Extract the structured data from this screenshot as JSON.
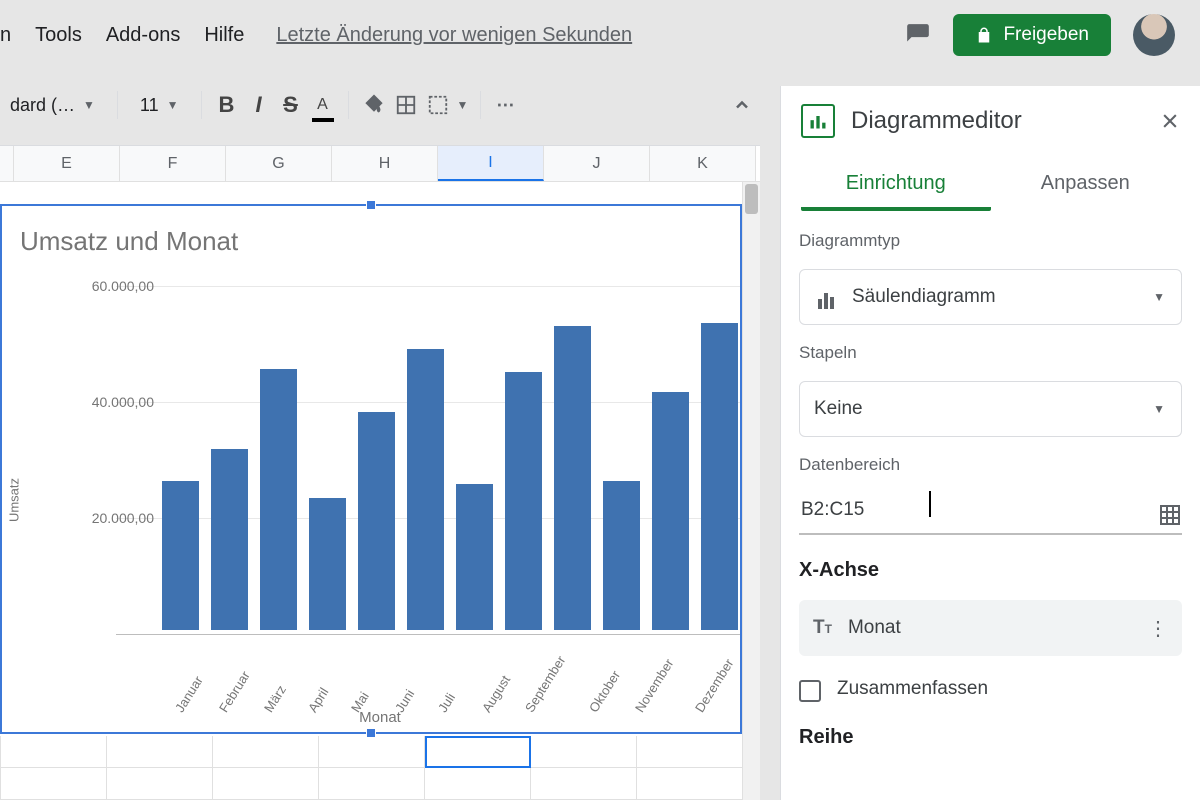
{
  "menu": {
    "items": [
      "n",
      "Tools",
      "Add-ons",
      "Hilfe"
    ],
    "last_change": "Letzte Änderung vor wenigen Sekunden"
  },
  "toolbar": {
    "font_name": "dard (…",
    "font_size": "11"
  },
  "share_label": "Freigeben",
  "columns": [
    "E",
    "F",
    "G",
    "H",
    "I",
    "J",
    "K"
  ],
  "selected_column_index": 4,
  "chart_data": {
    "type": "bar",
    "title": "Umsatz und Monat",
    "xlabel": "Monat",
    "ylabel": "Umsatz",
    "ylim": [
      0,
      60000
    ],
    "y_ticks": [
      "60.000,00",
      "40.000,00",
      "20.000,00"
    ],
    "categories": [
      "Januar",
      "Februar",
      "März",
      "April",
      "Mai",
      "Juni",
      "Juli",
      "August",
      "September",
      "Oktober",
      "November",
      "Dezember"
    ],
    "values": [
      26000,
      31500,
      45500,
      23000,
      38000,
      49000,
      25500,
      45000,
      53000,
      26000,
      41500,
      53500
    ]
  },
  "editor": {
    "title": "Diagrammeditor",
    "tabs": {
      "setup": "Einrichtung",
      "customize": "Anpassen"
    },
    "chart_type_label": "Diagrammtyp",
    "chart_type_value": "Säulendiagramm",
    "stacking_label": "Stapeln",
    "stacking_value": "Keine",
    "data_range_label": "Datenbereich",
    "data_range_value": "B2:C15",
    "x_axis_title": "X-Achse",
    "x_axis_field": "Monat",
    "aggregate_label": "Zusammenfassen",
    "series_title": "Reihe"
  }
}
